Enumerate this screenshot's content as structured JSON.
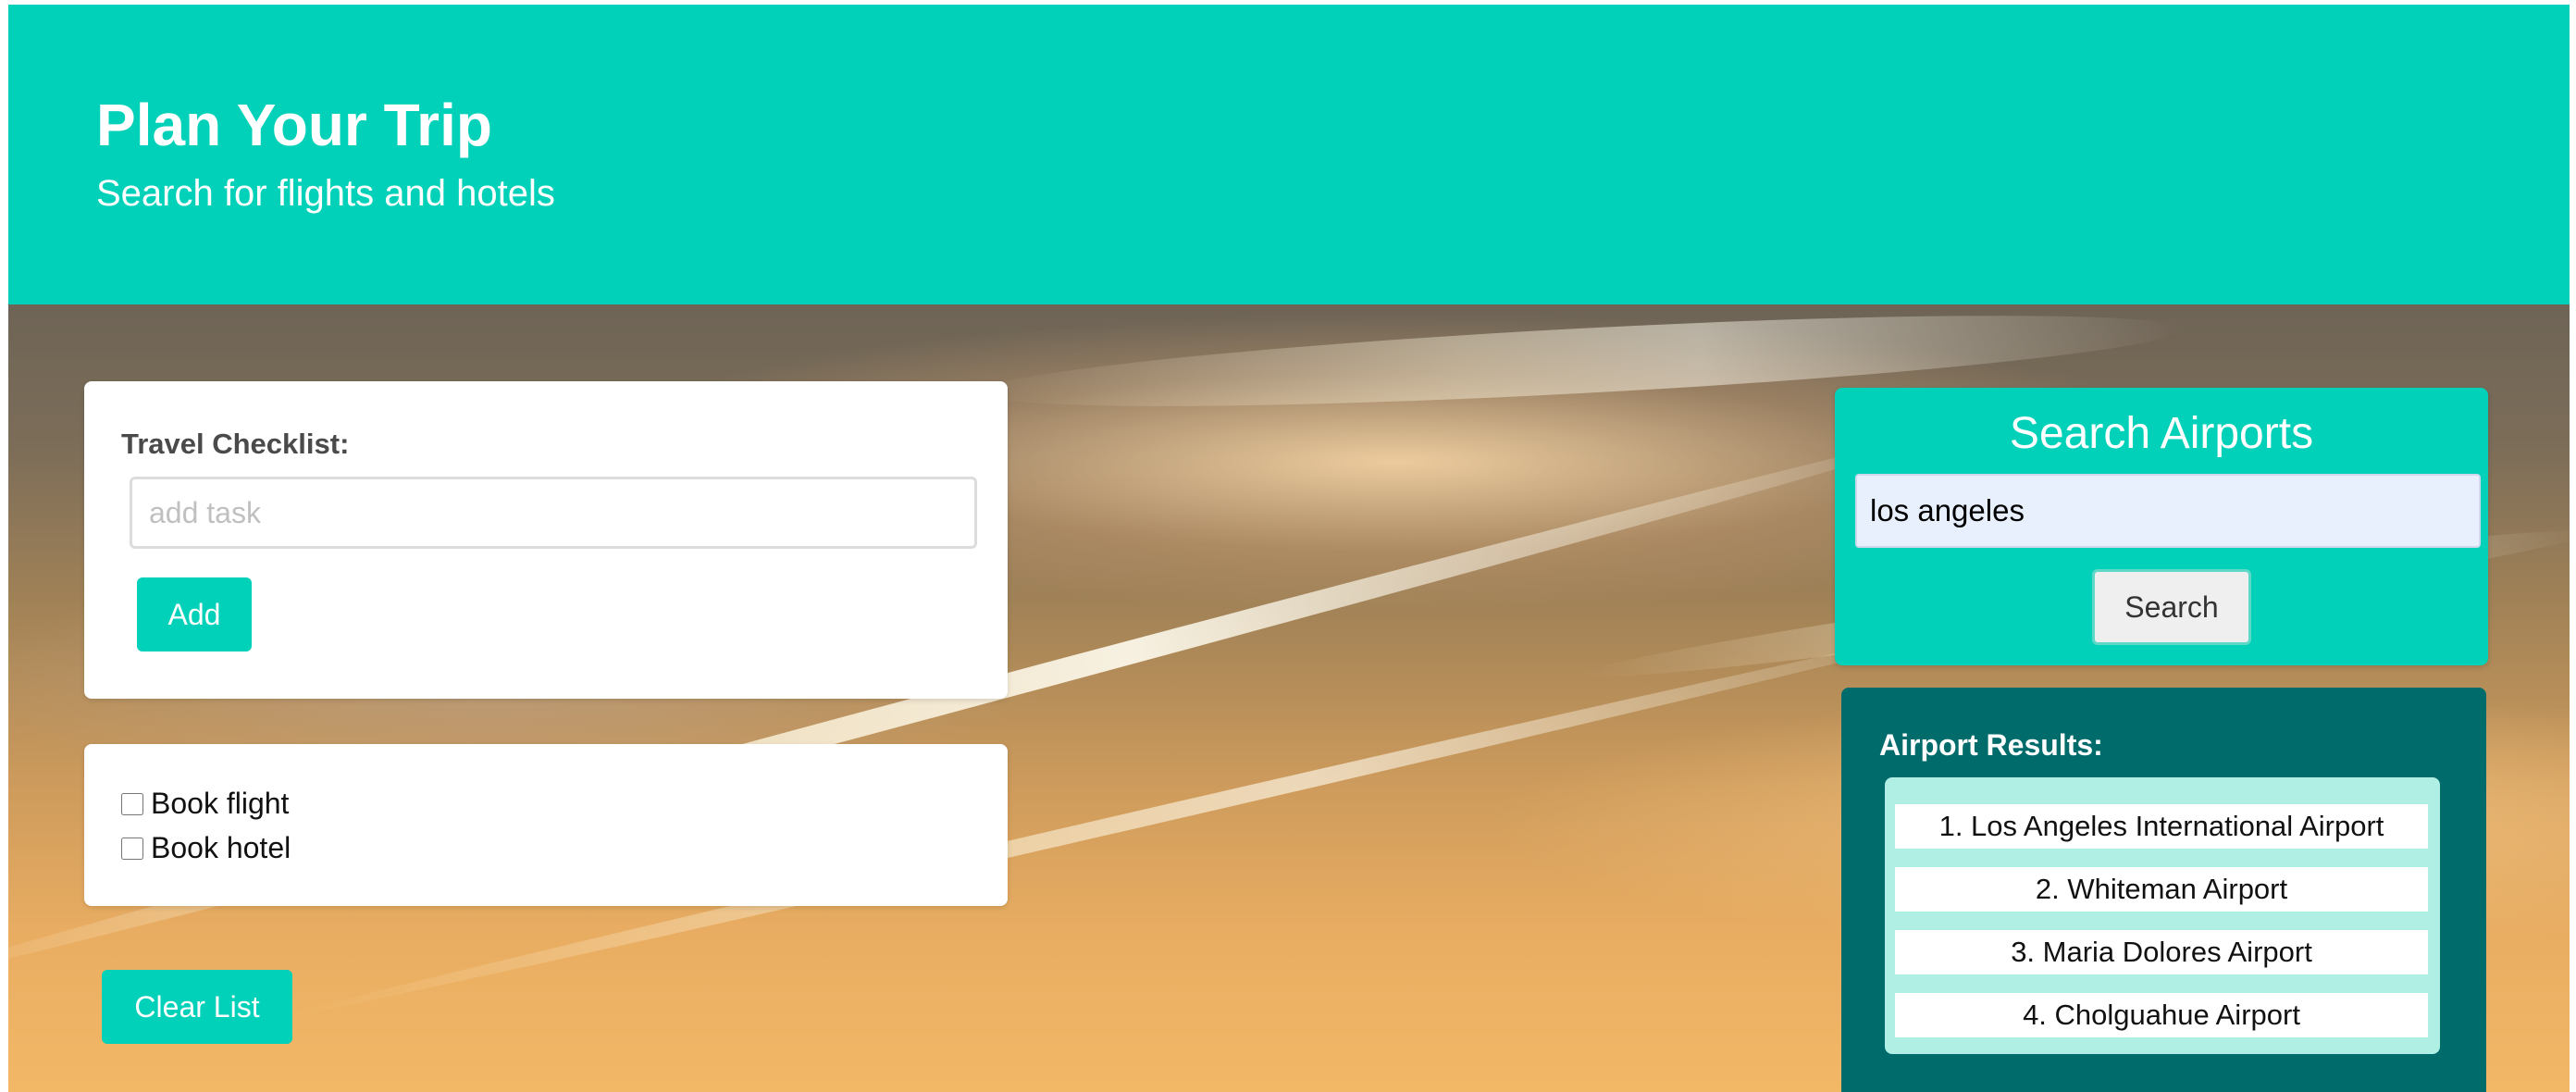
{
  "header": {
    "title": "Plan Your Trip",
    "subtitle": "Search for flights and hotels"
  },
  "checklist": {
    "label": "Travel Checklist:",
    "input_placeholder": "add task",
    "input_value": "",
    "add_label": "Add",
    "tasks": [
      {
        "label": "Book flight",
        "checked": false
      },
      {
        "label": "Book hotel",
        "checked": false
      }
    ],
    "clear_label": "Clear List"
  },
  "airport_search": {
    "title": "Search Airports",
    "input_value": "los angeles",
    "search_label": "Search"
  },
  "airport_results": {
    "label": "Airport Results:",
    "items": [
      "1. Los Angeles International Airport",
      "2. Whiteman Airport",
      "3. Maria Dolores Airport",
      "4. Cholguahue Airport"
    ]
  },
  "colors": {
    "accent": "#00d1b8",
    "results_panel": "#006b6b",
    "results_list": "#b0efe4"
  }
}
